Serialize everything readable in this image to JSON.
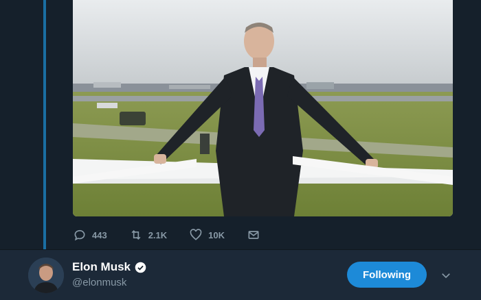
{
  "tweet": {
    "actions": {
      "reply_count": "443",
      "retweet_count": "2.1K",
      "like_count": "10K"
    },
    "icons": [
      "reply-icon",
      "retweet-icon",
      "like-icon",
      "dm-icon"
    ]
  },
  "user": {
    "name": "Elon Musk",
    "handle": "@elonmusk",
    "verified": true,
    "follow_label": "Following"
  },
  "colors": {
    "background": "#15202b",
    "user_bar": "#1c2938",
    "accent": "#1d8ad8",
    "muted_text": "#8899a6"
  }
}
